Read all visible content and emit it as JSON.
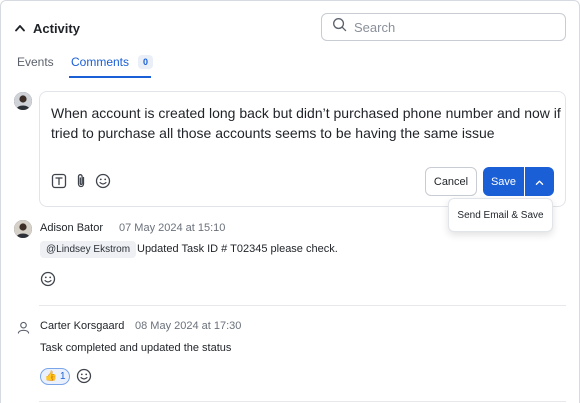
{
  "header": {
    "title": "Activity"
  },
  "search": {
    "placeholder": "Search",
    "value": ""
  },
  "tabs": [
    {
      "label": "Events",
      "active": false
    },
    {
      "label": "Comments",
      "count": "0",
      "active": true
    }
  ],
  "composer": {
    "text": "When account is created long back but didn’t purchased phone number and now if tried to purchase all those accounts seems to be having the same issue",
    "tools": [
      "text-format-icon",
      "attachment-icon",
      "emoji-icon"
    ],
    "cancel_label": "Cancel",
    "save_label": "Save",
    "dropdown_item": "Send Email & Save"
  },
  "comments": [
    {
      "author": "Adison Bator",
      "time": "07 May 2024 at 15:10",
      "mention": "@Lindsey Ekstrom",
      "text": "Updated Task ID # T02345 please check."
    },
    {
      "author": "Carter Korsgaard",
      "time": "08 May 2024 at 17:30",
      "text": "Task completed and updated the status",
      "reaction": {
        "emoji": "👍",
        "count": "1"
      }
    }
  ],
  "colors": {
    "accent": "#1a5fd6",
    "border": "#c8ccd3",
    "muted": "#6b717b"
  }
}
